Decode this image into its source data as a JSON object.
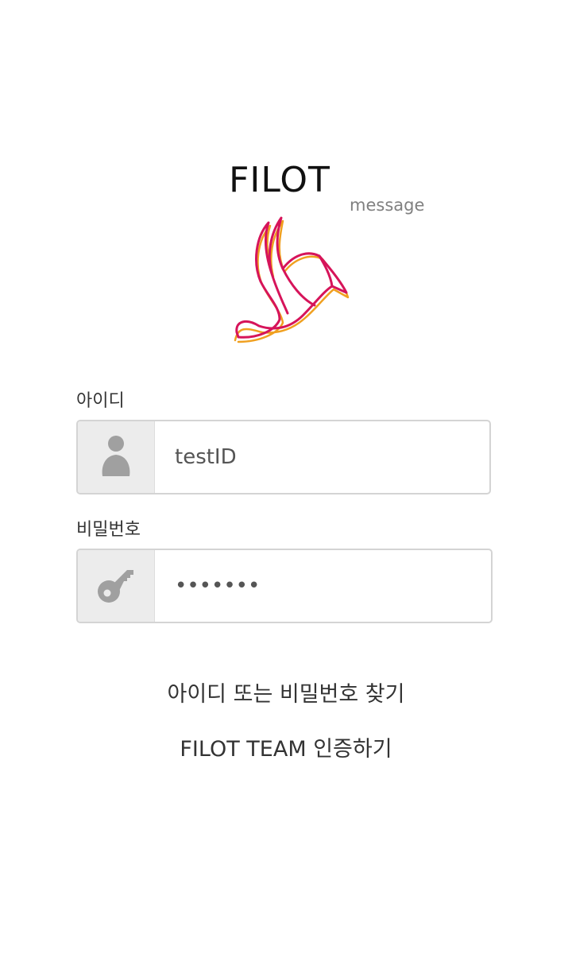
{
  "brand": {
    "title": "FILOT",
    "subtitle": "message"
  },
  "form": {
    "id_label": "아이디",
    "id_value": "testID",
    "id_icon": "user-icon",
    "password_label": "비밀번호",
    "password_value": "1234567",
    "password_icon": "key-icon"
  },
  "links": {
    "find_account": "아이디 또는 비밀번호 찾기",
    "team_auth": "FILOT TEAM 인증하기"
  },
  "colors": {
    "logo_primary": "#d6145a",
    "logo_accent": "#f0a020",
    "icon_gray": "#a0a0a0",
    "icon_box_bg": "#ececec",
    "field_border": "#d4d4d4"
  }
}
